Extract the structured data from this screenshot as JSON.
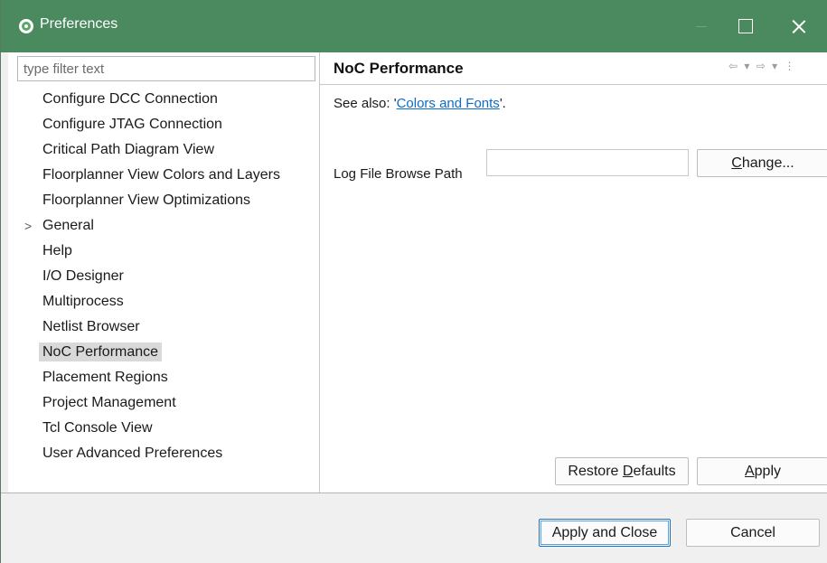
{
  "window": {
    "title": "Preferences",
    "icon": "app-logo-icon"
  },
  "filter": {
    "placeholder": "type filter text",
    "value": ""
  },
  "tree": [
    {
      "label": "Configure DCC Connection",
      "expandable": false
    },
    {
      "label": "Configure JTAG Connection",
      "expandable": false
    },
    {
      "label": "Critical Path Diagram View",
      "expandable": false
    },
    {
      "label": "Floorplanner View Colors and Layers",
      "expandable": false
    },
    {
      "label": "Floorplanner View Optimizations",
      "expandable": false
    },
    {
      "label": "General",
      "expandable": true,
      "expander": ">"
    },
    {
      "label": "Help",
      "expandable": false
    },
    {
      "label": "I/O Designer",
      "expandable": false
    },
    {
      "label": "Multiprocess",
      "expandable": false
    },
    {
      "label": "Netlist Browser",
      "expandable": false
    },
    {
      "label": "NoC Performance",
      "expandable": false,
      "selected": true
    },
    {
      "label": "Placement Regions",
      "expandable": false
    },
    {
      "label": "Project Management",
      "expandable": false
    },
    {
      "label": "Tcl Console View",
      "expandable": false
    },
    {
      "label": "User Advanced Preferences",
      "expandable": false
    }
  ],
  "page": {
    "title": "NoC Performance",
    "nav_icons": "⇦ ▾ ⇨ ▾ ⋮",
    "see_also_prefix": "See also: '",
    "see_also_link": "Colors and Fonts",
    "see_also_suffix": "'.",
    "field_label": "Log File Browse Path",
    "field_value": "",
    "change_button": {
      "pre": "",
      "mnemonic": "C",
      "post": "hange..."
    },
    "restore_button": {
      "pre": "Restore ",
      "mnemonic": "D",
      "post": "efaults"
    },
    "apply_button": {
      "pre": "",
      "mnemonic": "A",
      "post": "pply"
    }
  },
  "footer": {
    "apply_close_label": "Apply and Close",
    "cancel_label": "Cancel"
  },
  "colors": {
    "titlebar": "#4b8a5e",
    "link": "#0b6cc9",
    "selection": "#d9d9d9",
    "default_button_border": "#1a73c8"
  }
}
